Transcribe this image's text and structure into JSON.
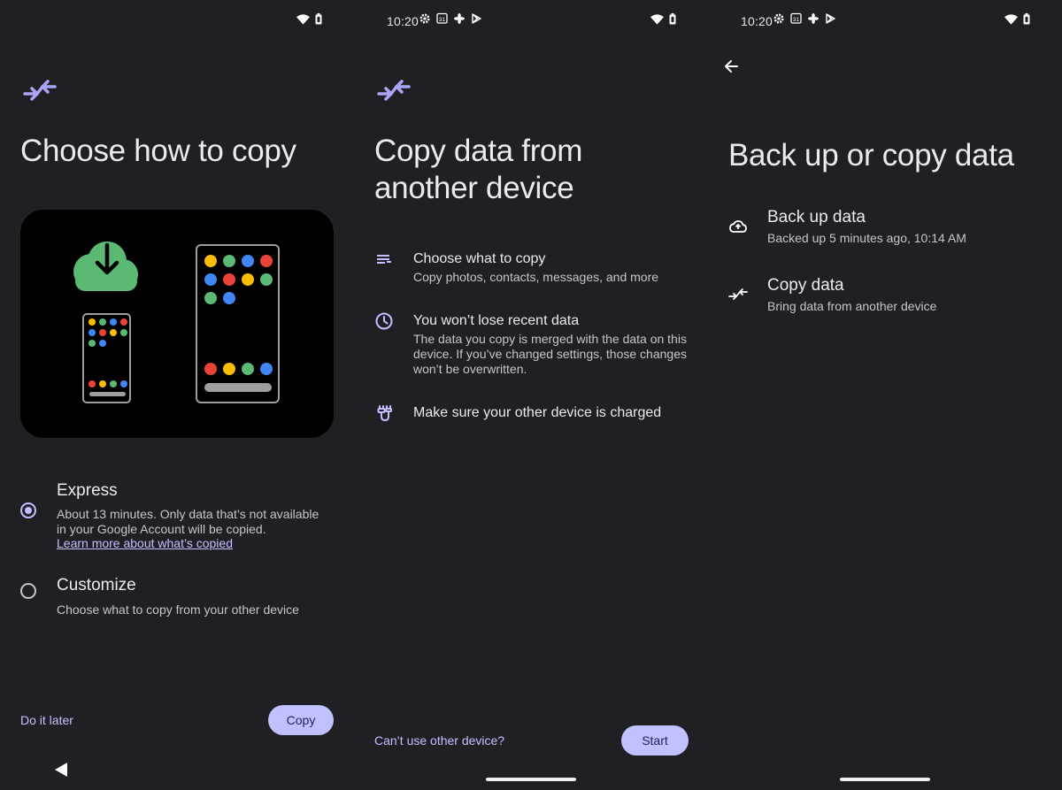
{
  "status": {
    "time": "10:20"
  },
  "screen1": {
    "title": "Choose how to copy",
    "options": [
      {
        "title": "Express",
        "desc": "About 13 minutes. Only data that’s not available in your Google Account will be copied.",
        "link": "Learn more about what’s copied",
        "selected": true
      },
      {
        "title": "Customize",
        "desc": "Choose what to copy from your other device",
        "selected": false
      }
    ],
    "secondary_label": "Do it later",
    "primary_label": "Copy"
  },
  "screen2": {
    "title": "Copy data from another device",
    "items": [
      {
        "icon": "list-icon",
        "title": "Choose what to copy",
        "desc": "Copy photos, contacts, messages, and more"
      },
      {
        "icon": "clock-icon",
        "title": "You won’t lose recent data",
        "desc": "The data you copy is merged with the data on this device. If you’ve changed settings, those changes won’t be overwritten."
      },
      {
        "icon": "charging-cable-icon",
        "title": "Make sure your other device is charged",
        "desc": ""
      }
    ],
    "secondary_label": "Can’t use other device?",
    "primary_label": "Start"
  },
  "screen3": {
    "title": "Back up or copy data",
    "rows": [
      {
        "icon": "cloud-backup-icon",
        "title": "Back up data",
        "desc": "Backed up 5 minutes ago, 10:14 AM"
      },
      {
        "icon": "copy-arrows-icon",
        "title": "Copy data",
        "desc": "Bring data from another device"
      }
    ]
  },
  "colors": {
    "background": "#202024",
    "accent": "#c2c1ff",
    "green": "#5bb974",
    "yellow": "#fbbc04",
    "red": "#ea4335",
    "blue": "#4285f4"
  }
}
